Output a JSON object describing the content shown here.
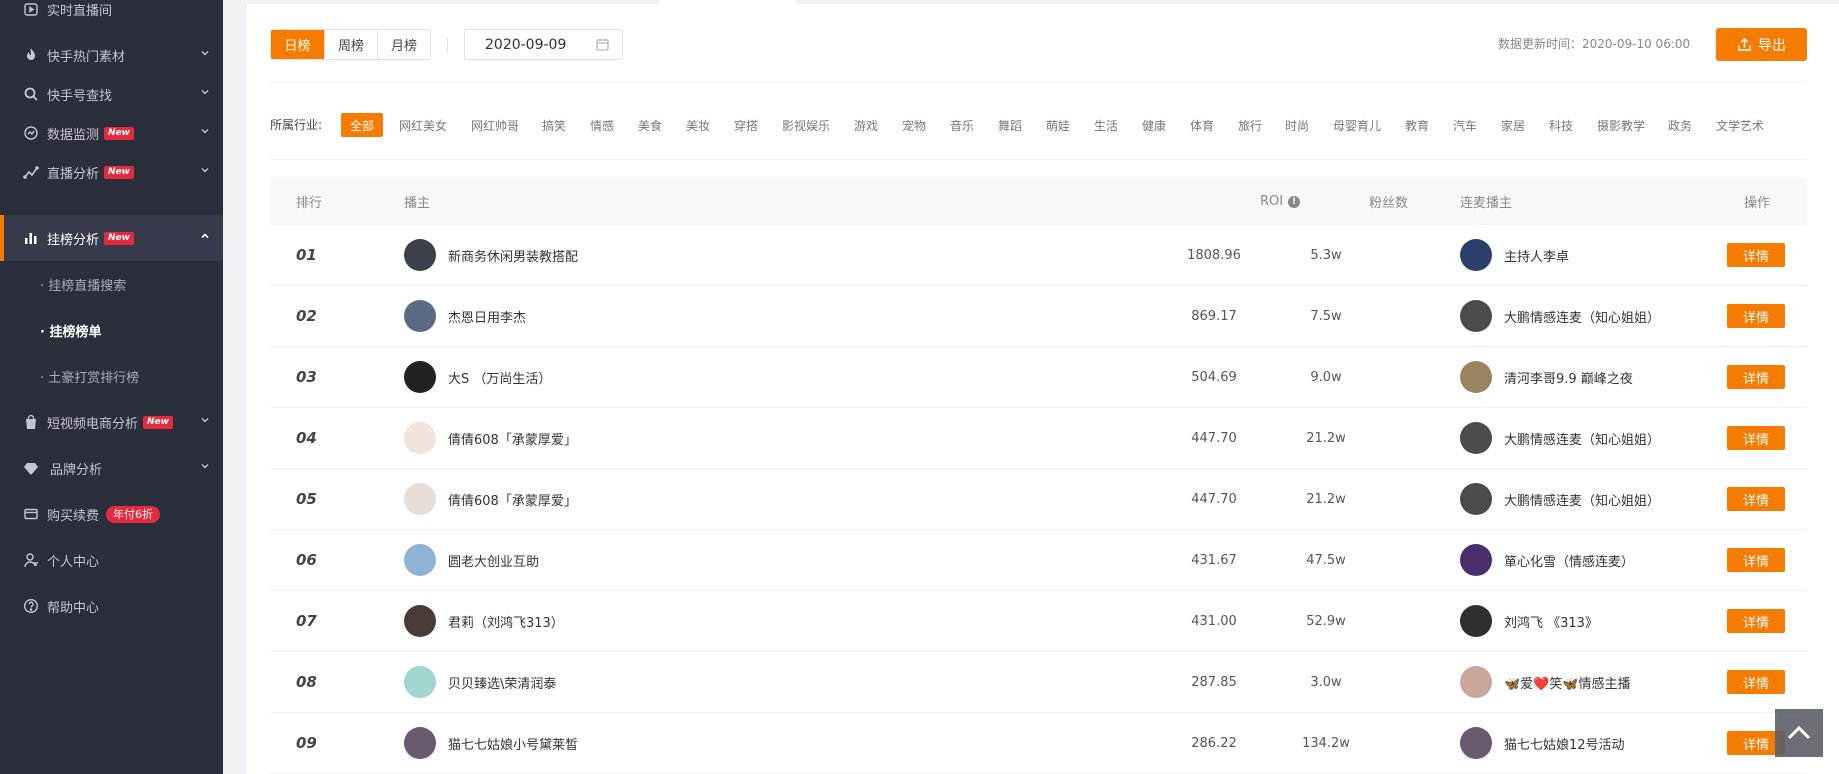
{
  "sidebar": {
    "items": [
      {
        "label": "实时直播间",
        "icon": "video-icon"
      },
      {
        "label": "快手热门素材",
        "icon": "fire-icon"
      },
      {
        "label": "快手号查找",
        "icon": "search-icon"
      },
      {
        "label": "数据监测",
        "icon": "monitor-icon",
        "badge": "New"
      },
      {
        "label": "直播分析",
        "icon": "trend-icon",
        "badge": "New"
      },
      {
        "label": "挂榜分析",
        "icon": "bar-chart-icon",
        "badge": "New"
      },
      {
        "label": "短视频电商分析",
        "icon": "shop-bag-icon",
        "badge": "New"
      },
      {
        "label": "品牌分析",
        "icon": "diamond-icon"
      },
      {
        "label": "购买续费",
        "icon": "card-icon",
        "badge": "年付6折"
      },
      {
        "label": "个人中心",
        "icon": "user-icon"
      },
      {
        "label": "帮助中心",
        "icon": "help-icon"
      }
    ],
    "sub_items": [
      "· 挂榜直播搜索",
      "· 挂榜榜单",
      "· 土豪打赏排行榜"
    ]
  },
  "toolbar": {
    "tabs": [
      "日榜",
      "周榜",
      "月榜"
    ],
    "active_tab": "日榜",
    "date": "2020-09-09",
    "update_time": "数据更新时间：2020-09-10 06:00",
    "export_label": "导出"
  },
  "industry": {
    "label": "所属行业:",
    "items": [
      "全部",
      "网红美女",
      "网红帅哥",
      "搞笑",
      "情感",
      "美食",
      "美妆",
      "穿搭",
      "影视娱乐",
      "游戏",
      "宠物",
      "音乐",
      "舞蹈",
      "萌娃",
      "生活",
      "健康",
      "体育",
      "旅行",
      "时尚",
      "母婴育儿",
      "教育",
      "汽车",
      "家居",
      "科技",
      "摄影教学",
      "政务",
      "文学艺术"
    ],
    "active": "全部"
  },
  "table": {
    "headers": {
      "rank": "排行",
      "anchor": "播主",
      "roi": "ROI",
      "fans": "粉丝数",
      "lianmai": "连麦播主",
      "op": "操作"
    },
    "detail_label": "详情",
    "rows": [
      {
        "rank": "01",
        "anchor": "新商务休闲男装教搭配",
        "roi": "1808.96",
        "fans": "5.3w",
        "lianmai": "主持人李卓"
      },
      {
        "rank": "02",
        "anchor": "杰恩日用李杰",
        "roi": "869.17",
        "fans": "7.5w",
        "lianmai": "大鹏情感连麦（知心姐姐）"
      },
      {
        "rank": "03",
        "anchor": "大S （万尚生活）",
        "roi": "504.69",
        "fans": "9.0w",
        "lianmai": "清河李哥9.9 巅峰之夜"
      },
      {
        "rank": "04",
        "anchor": "倩倩608「承蒙厚爱」",
        "roi": "447.70",
        "fans": "21.2w",
        "lianmai": "大鹏情感连麦（知心姐姐）"
      },
      {
        "rank": "05",
        "anchor": "倩倩608「承蒙厚爱」",
        "roi": "447.70",
        "fans": "21.2w",
        "lianmai": "大鹏情感连麦（知心姐姐）"
      },
      {
        "rank": "06",
        "anchor": "圆老大创业互助",
        "roi": "431.67",
        "fans": "47.5w",
        "lianmai": "箪心化雪（情感连麦）"
      },
      {
        "rank": "07",
        "anchor": "君莉（刘鸿飞313）",
        "roi": "431.00",
        "fans": "52.9w",
        "lianmai": "刘鸿飞 《313》"
      },
      {
        "rank": "08",
        "anchor": "贝贝臻选\\荣清润泰",
        "roi": "287.85",
        "fans": "3.0w",
        "lianmai": "🦋爱❤️笑🦋情感主播"
      },
      {
        "rank": "09",
        "anchor": "猫七七姑娘小号黛莱皙",
        "roi": "286.22",
        "fans": "134.2w",
        "lianmai": "猫七七姑娘12号活动"
      }
    ]
  },
  "colors": {
    "accent": "#f57c00",
    "sidebar_bg": "#2b2e3b",
    "badge": "#e62a3d"
  }
}
